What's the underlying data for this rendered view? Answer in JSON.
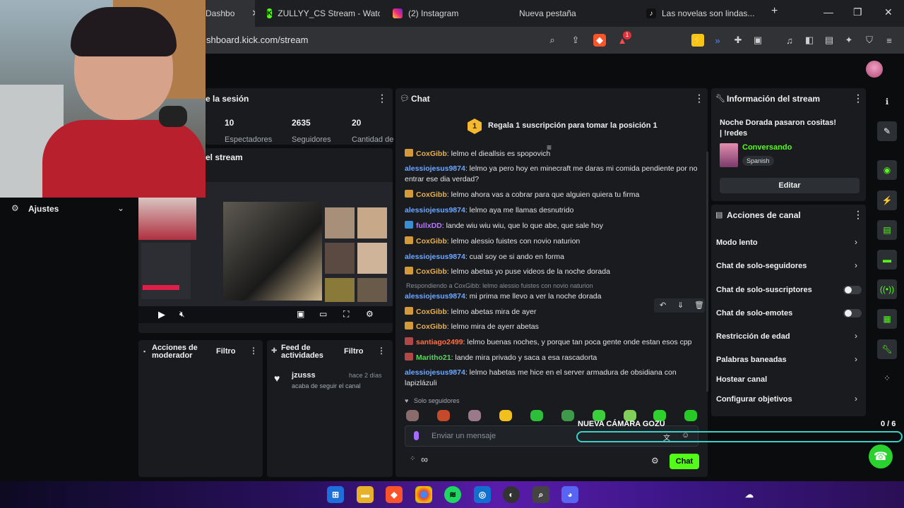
{
  "browser": {
    "tabs": [
      {
        "label": "Dashbo",
        "active": true
      },
      {
        "label": "ZULLYY_CS Stream - Watc",
        "active": false
      },
      {
        "label": "(2) Instagram",
        "active": false
      },
      {
        "label": "Nueva pestaña",
        "active": false
      },
      {
        "label": "Las novelas son lindas...",
        "active": false
      }
    ],
    "new_tab": "+",
    "url": "shboard.kick.com/stream",
    "brave_badge": "1"
  },
  "left_menu": {
    "settings_label": "Ajustes"
  },
  "session": {
    "title": "e la sesión",
    "stats": [
      {
        "value": "10",
        "label": "Espectadores"
      },
      {
        "value": "2635",
        "label": "Seguidores"
      },
      {
        "value": "20",
        "label": "Cantidad de"
      }
    ]
  },
  "preview": {
    "title": "el stream"
  },
  "mod_actions": {
    "title": "Acciones de moderador",
    "filter": "Filtro"
  },
  "activity_feed": {
    "title": "Feed de actividades",
    "filter": "Filtro",
    "items": [
      {
        "user": "jzusss",
        "text": "acaba de seguir el canal",
        "time": "hace 2 días"
      }
    ]
  },
  "chat": {
    "title": "Chat",
    "promo": "Regala 1 suscripción para tomar la posición 1",
    "promo_rank": "1",
    "messages": [
      {
        "user": "CoxGibb",
        "text": ": lelmo el dieallsis es spopovich",
        "color": "#e8b04a",
        "badge": "b1"
      },
      {
        "user": "alessiojesus9874",
        "text": ": lelmo ya pero hoy en minecraft me daras mi comida pendiente por no entrar ese dia verdad?",
        "color": "#6ea8ff",
        "badge": ""
      },
      {
        "user": "CoxGibb",
        "text": ": lelmo ahora vas a cobrar para que alguien quiera tu firma",
        "color": "#e8b04a",
        "badge": "b1"
      },
      {
        "user": "alessiojesus9874",
        "text": ": lelmo aya me llamas desnutrido",
        "color": "#6ea8ff",
        "badge": ""
      },
      {
        "user": "fullxDD",
        "text": ": lande wiu wiu wiu, que lo que abe, que sale hoy",
        "color": "#b877ff",
        "badge": "b2"
      },
      {
        "user": "CoxGibb",
        "text": ": lelmo alessio fuistes con novio naturion",
        "color": "#e8b04a",
        "badge": "b1"
      },
      {
        "user": "alessiojesus9874",
        "text": ": cual soy oe si ando en forma",
        "color": "#6ea8ff",
        "badge": ""
      },
      {
        "user": "CoxGibb",
        "text": ": lelmo abetas yo puse videos de la noche dorada",
        "color": "#e8b04a",
        "badge": "b1"
      }
    ],
    "reply_note": "Respondiendo a CoxGibb: lelmo alessio fuistes con novio naturion",
    "messages2": [
      {
        "user": "alessiojesus9874",
        "text": ": mi prima me llevo a ver la noche dorada",
        "color": "#6ea8ff",
        "badge": ""
      },
      {
        "user": "CoxGibb",
        "text": ": lelmo abetas mira de ayer",
        "color": "#e8b04a",
        "badge": "b1"
      },
      {
        "user": "CoxGibb",
        "text": ": lelmo mira de ayerr abetas",
        "color": "#e8b04a",
        "badge": "b1"
      },
      {
        "user": "santiago2499",
        "text": ": lelmo buenas noches, y porque tan poca gente onde estan esos cpp",
        "color": "#ff7043",
        "badge": "b3"
      },
      {
        "user": "Maritho21",
        "text": ": lande mira privado y saca a esa rascadorta",
        "color": "#5ad65a",
        "badge": "b3"
      },
      {
        "user": "alessiojesus9874",
        "text": ": lelmo habetas me hice en el server armadura de obsidiana con lapizlázuli",
        "color": "#6ea8ff",
        "badge": ""
      }
    ],
    "followers_only": "Solo seguidores",
    "input_placeholder": "Enviar un mensaje",
    "send_label": "Chat",
    "overlay_text": "NUEVA CÁMARA GOZU",
    "overlay_progress": "0 / 6",
    "infinity": "∞"
  },
  "stream_info": {
    "title": "Información del stream",
    "stream_title": "Noche Dorada pasaron cositas! | !redes",
    "category": "Conversando",
    "language": "Spanish",
    "edit_label": "Editar"
  },
  "channel_actions": {
    "title": "Acciones de canal",
    "items": [
      {
        "label": "Modo lento",
        "control": "chevron"
      },
      {
        "label": "Chat de solo-seguidores",
        "control": "chevron"
      },
      {
        "label": "Chat de solo-suscriptores",
        "control": "toggle"
      },
      {
        "label": "Chat de solo-emotes",
        "control": "toggle"
      },
      {
        "label": "Restricción de edad",
        "control": "chevron"
      },
      {
        "label": "Palabras baneadas",
        "control": "chevron"
      },
      {
        "label": "Hostear canal",
        "control": "none"
      },
      {
        "label": "Configurar objetivos",
        "control": "chevron"
      }
    ]
  },
  "colors": {
    "accent": "#53fc18",
    "panel": "#191b1f",
    "background": "#0b0c0d"
  }
}
